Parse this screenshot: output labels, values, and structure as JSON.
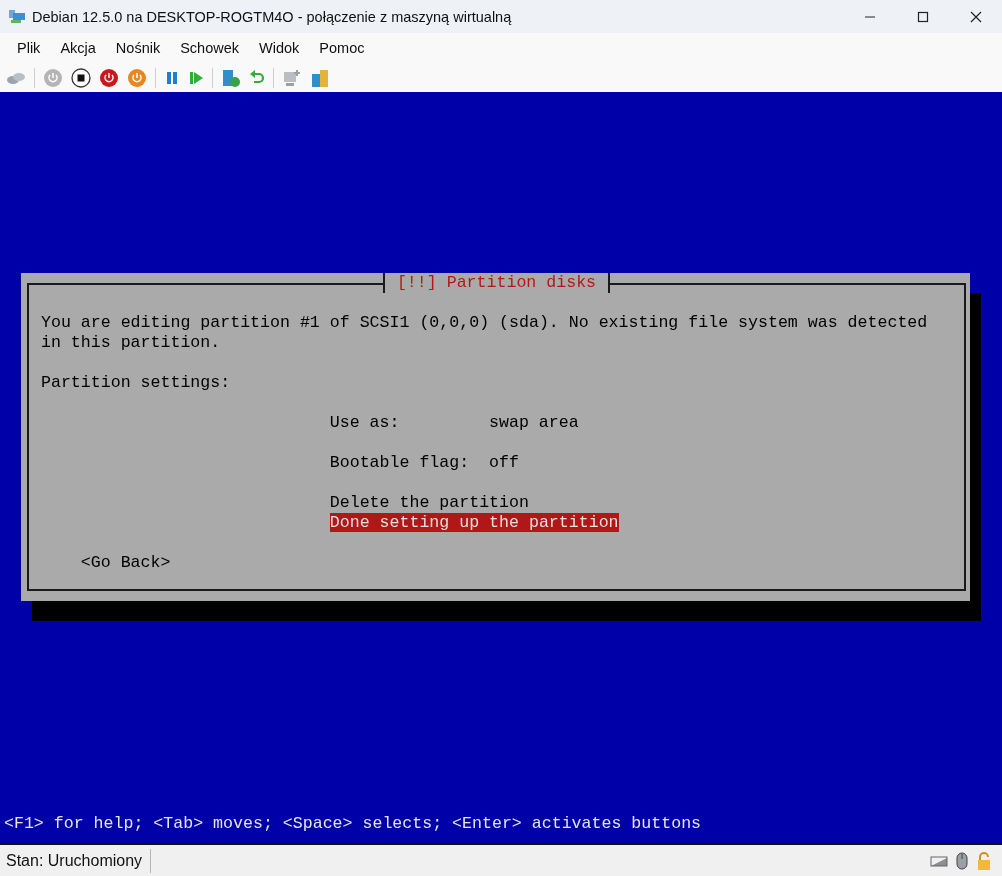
{
  "window": {
    "title": "Debian 12.5.0 na DESKTOP-ROGTM4O - połączenie z maszyną wirtualną"
  },
  "menu": [
    "Plik",
    "Akcja",
    "Nośnik",
    "Schowek",
    "Widok",
    "Pomoc"
  ],
  "dialog": {
    "title": "[!!] Partition disks",
    "message": "You are editing partition #1 of SCSI1 (0,0,0) (sda). No existing file system was detected in this partition.",
    "section_label": "Partition settings:",
    "options": [
      {
        "kind": "setting",
        "label": "Use as:",
        "value": "swap area",
        "selected": false
      },
      {
        "kind": "setting",
        "label": "Bootable flag:",
        "value": "off",
        "selected": false
      },
      {
        "kind": "action",
        "label": "Delete the partition",
        "selected": false
      },
      {
        "kind": "action",
        "label": "Done setting up the partition",
        "selected": true
      }
    ],
    "back_button": "<Go Back>"
  },
  "hint": "<F1> for help; <Tab> moves; <Space> selects; <Enter> activates buttons",
  "status_bar": {
    "status": "Stan: Uruchomiony"
  }
}
